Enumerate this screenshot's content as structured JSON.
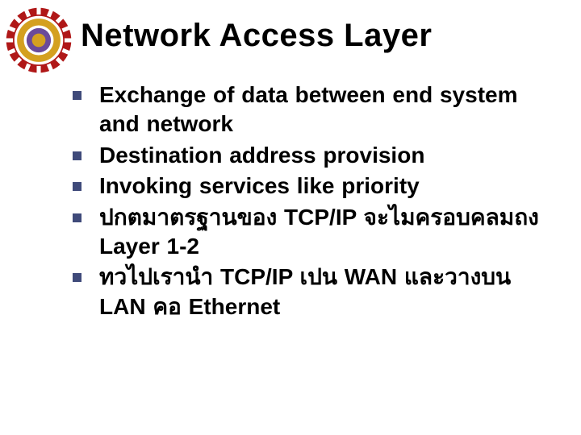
{
  "title": "Network Access Layer",
  "bullets": [
    "Exchange of data between end system and network",
    "Destination address provision",
    "Invoking services like priority",
    "ปกตมาตรฐานของ   TCP/IP จะไมครอบคลมถง      Layer 1-2",
    "ทวไปเรานำ      TCP/IP เปน   WAN และวางบน LAN คอ   Ethernet"
  ],
  "colors": {
    "bullet": "#3f4a7a",
    "gear": "#b01818",
    "ring": "#d4a020",
    "inner": "#6a4a9a"
  }
}
